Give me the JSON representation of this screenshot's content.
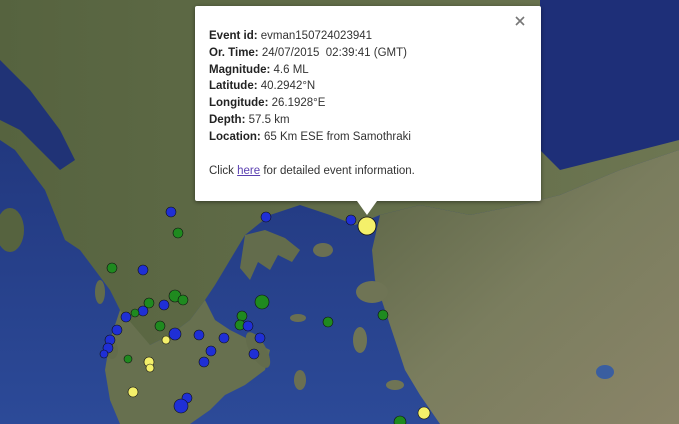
{
  "popup": {
    "fields": [
      {
        "label": "Event id:",
        "value": "evman150724023941"
      },
      {
        "label": "Or. Time:",
        "value": "24/07/2015  02:39:41 (GMT)"
      },
      {
        "label": "Magnitude:",
        "value": "4.6 ML"
      },
      {
        "label": "Latitude:",
        "value": "40.2942°N"
      },
      {
        "label": "Longitude:",
        "value": "26.1928°E"
      },
      {
        "label": "Depth:",
        "value": "57.5 km"
      },
      {
        "label": "Location:",
        "value": "65 Km ESE from Samothraki"
      }
    ],
    "click_prefix": "Click",
    "link_text": "here",
    "click_suffix": "for detailed event information.",
    "close_icon": "close-icon"
  },
  "colors": {
    "sea_deep": "#223a82",
    "sea": "#2f4f9c",
    "land": "#6f7655",
    "marker_blue": "#1f2fd6",
    "marker_green": "#1f8a1f",
    "marker_yellow": "#f4f06a"
  }
}
